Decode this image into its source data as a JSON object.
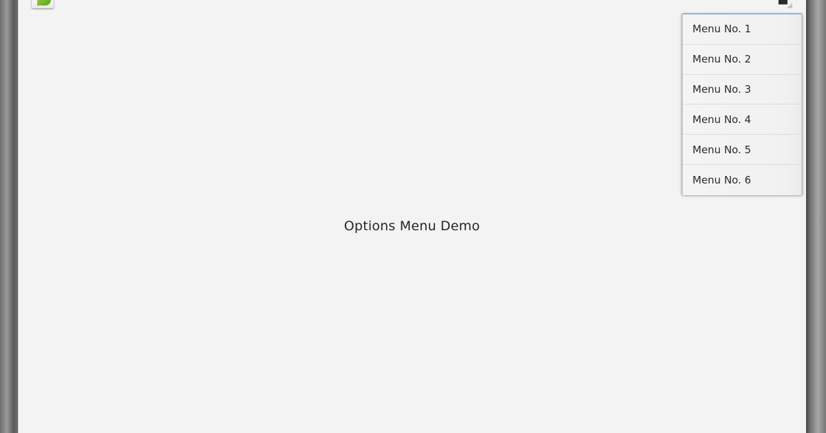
{
  "app": {
    "icon": "android-app-icon",
    "overflow_icon": "overflow-menu-icon"
  },
  "menu": {
    "items": [
      {
        "label": "Menu No. 1"
      },
      {
        "label": "Menu No. 2"
      },
      {
        "label": "Menu No. 3"
      },
      {
        "label": "Menu No. 4"
      },
      {
        "label": "Menu No. 5"
      },
      {
        "label": "Menu No. 6"
      }
    ],
    "accent_color": "#8db3e6"
  },
  "content": {
    "title": "Options Menu Demo"
  },
  "colors": {
    "screen_background": "#f3f3f3",
    "menu_background": "#f2f2f2"
  }
}
